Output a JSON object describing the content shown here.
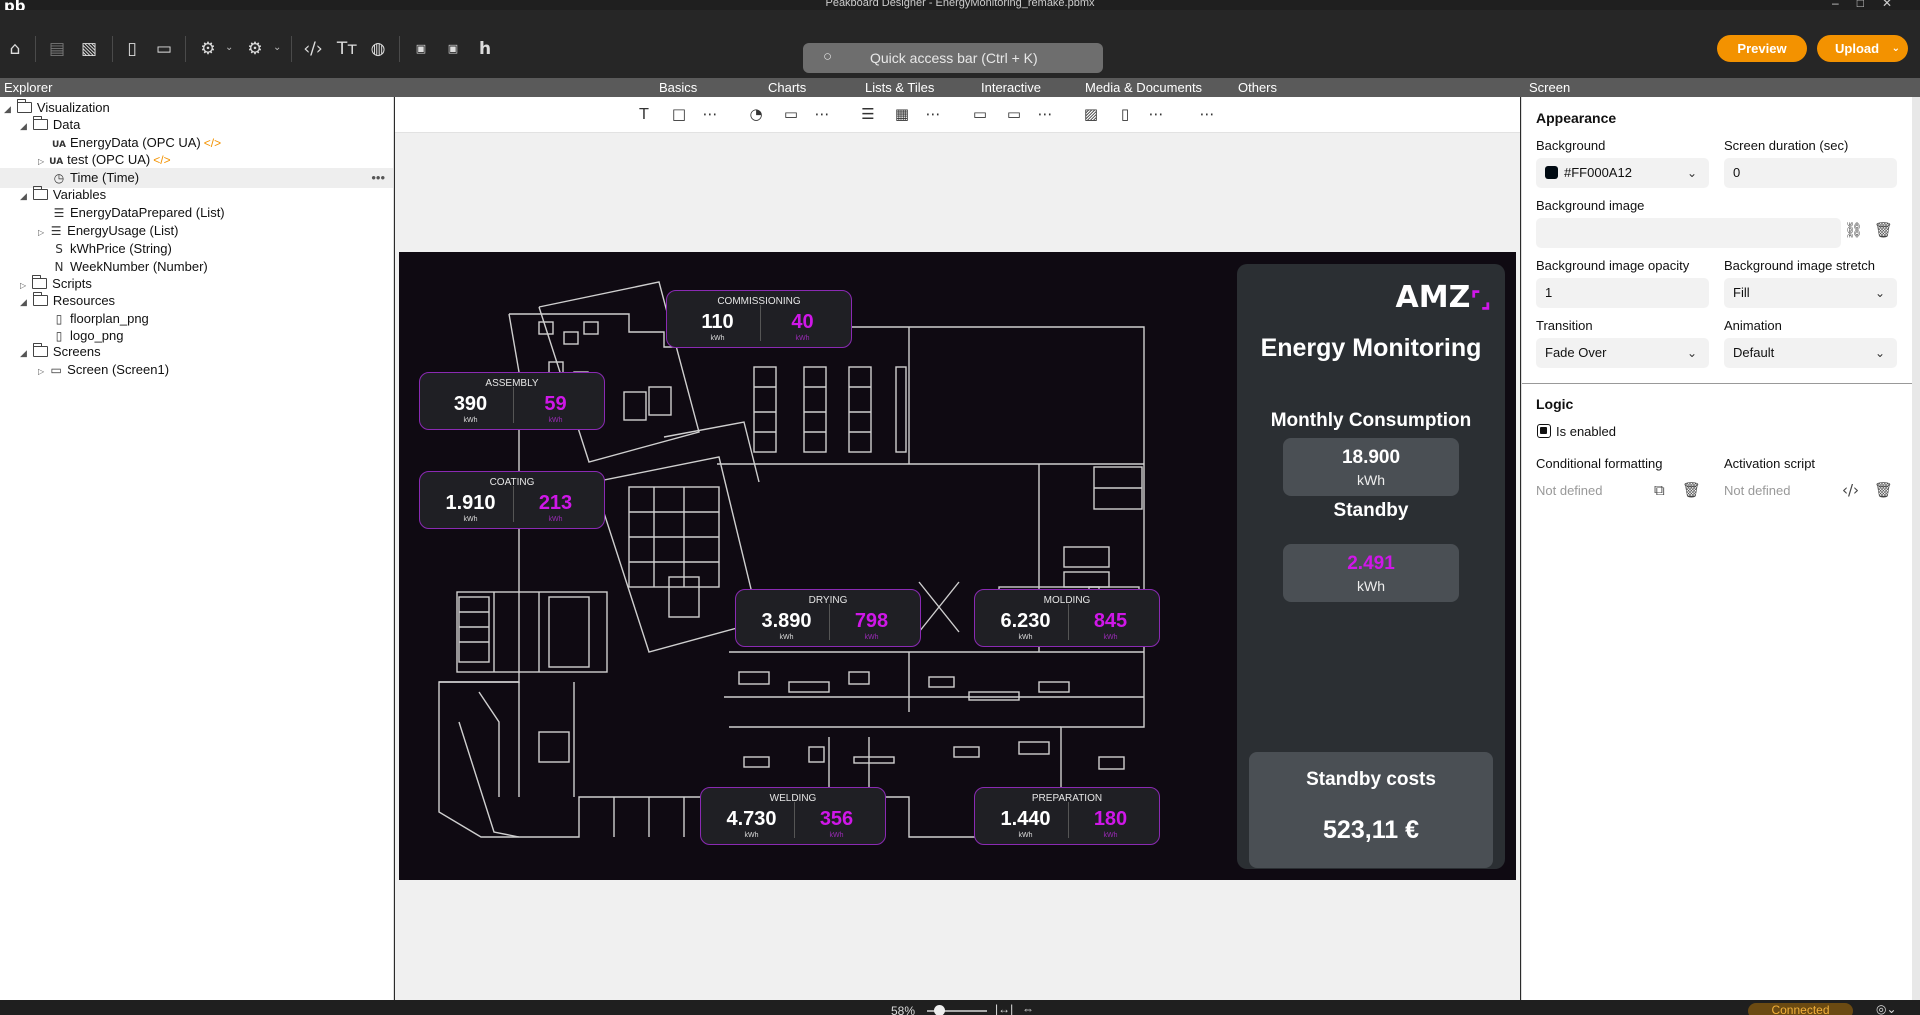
{
  "app": {
    "title": "Peakboard Designer - EnergyMonitoring_remake.pbmx",
    "logo": "pb"
  },
  "toolbar": {
    "quick_access_placeholder": "Quick access bar (Ctrl + K)",
    "preview_label": "Preview",
    "upload_label": "Upload"
  },
  "explorer": {
    "header": "Explorer",
    "tree": {
      "visualization": "Visualization",
      "data": "Data",
      "energy_data": "EnergyData (OPC UA)",
      "test": "test (OPC UA)",
      "time": "Time (Time)",
      "variables": "Variables",
      "energy_data_prepared": "EnergyDataPrepared (List)",
      "energy_usage": "EnergyUsage (List)",
      "kwh_price": "kWhPrice (String)",
      "week_number": "WeekNumber (Number)",
      "scripts": "Scripts",
      "resources": "Resources",
      "floorplan": "floorplan_png",
      "logo": "logo_png",
      "screens": "Screens",
      "screen1": "Screen (Screen1)"
    },
    "code_tag": "</>",
    "dots": "•••"
  },
  "element_tabs": [
    "Basics",
    "Charts",
    "Lists & Tiles",
    "Interactive",
    "Media & Documents",
    "Others"
  ],
  "dashboard": {
    "zones": [
      {
        "name": "COMMISSIONING",
        "total": "110",
        "standby": "40",
        "unit": "kWh"
      },
      {
        "name": "ASSEMBLY",
        "total": "390",
        "standby": "59",
        "unit": "kWh"
      },
      {
        "name": "COATING",
        "total": "1.910",
        "standby": "213",
        "unit": "kWh"
      },
      {
        "name": "DRYING",
        "total": "3.890",
        "standby": "798",
        "unit": "kWh"
      },
      {
        "name": "MOLDING",
        "total": "6.230",
        "standby": "845",
        "unit": "kWh"
      },
      {
        "name": "WELDING",
        "total": "4.730",
        "standby": "356",
        "unit": "kWh"
      },
      {
        "name": "PREPARATION",
        "total": "1.440",
        "standby": "180",
        "unit": "kWh"
      }
    ],
    "logo_text": "AMZ",
    "title": "Energy Monitoring",
    "monthly_label": "Monthly Consumption",
    "monthly_value": "18.900",
    "monthly_unit": "kWh",
    "standby_label": "Standby",
    "standby_value": "2.491",
    "standby_unit": "kWh",
    "costs_label": "Standby costs",
    "costs_value": "523,11 €",
    "colors": {
      "accent": "#cf17e8",
      "background": "#0f0a12",
      "panel": "#2b2f33"
    }
  },
  "properties": {
    "header": "Screen",
    "appearance": "Appearance",
    "background_label": "Background",
    "background_value": "#FF000A12",
    "screen_duration_label": "Screen duration (sec)",
    "screen_duration_value": "0",
    "background_image_label": "Background image",
    "bg_opacity_label": "Background image opacity",
    "bg_opacity_value": "1",
    "bg_stretch_label": "Background image stretch",
    "bg_stretch_value": "Fill",
    "transition_label": "Transition",
    "transition_value": "Fade Over",
    "animation_label": "Animation",
    "animation_value": "Default",
    "logic": "Logic",
    "is_enabled_label": "Is enabled",
    "is_enabled": true,
    "cond_format_label": "Conditional formatting",
    "cond_format_value": "Not defined",
    "activation_label": "Activation script",
    "activation_value": "Not defined"
  },
  "statusbar": {
    "zoom": "58%",
    "connection": "Connected"
  }
}
